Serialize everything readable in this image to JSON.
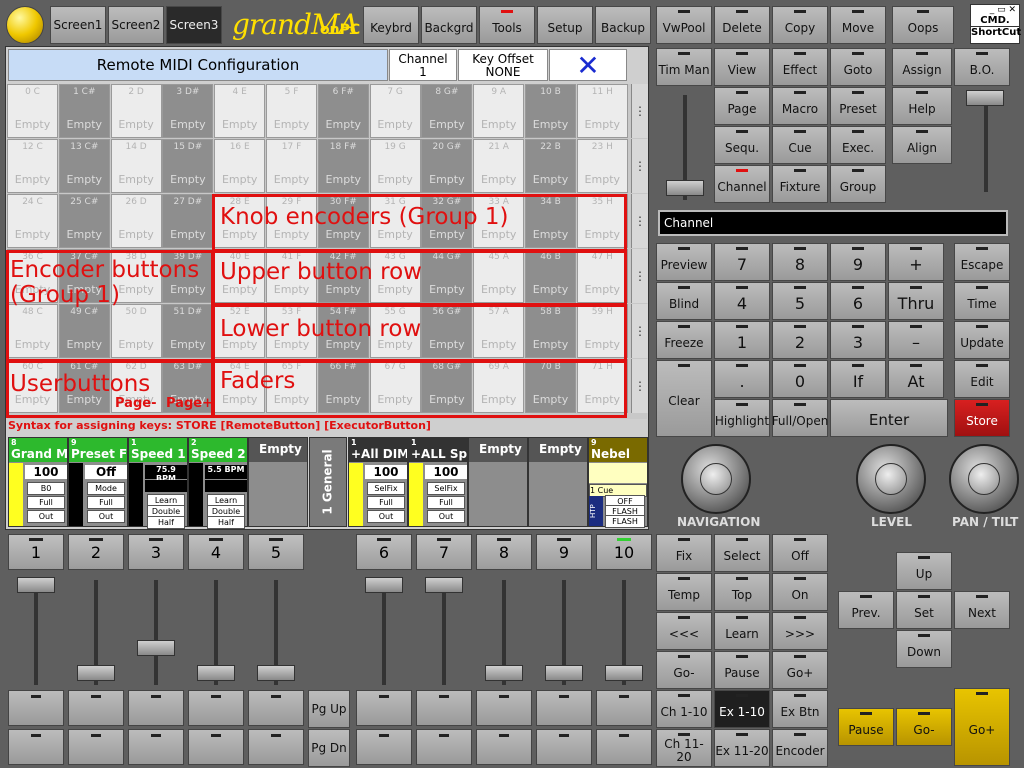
{
  "top_tabs": [
    "Screen1",
    "Screen2",
    "Screen3"
  ],
  "logo": {
    "main": "grandMA",
    "sub": "onPC"
  },
  "tools": [
    "Keybrd",
    "Backgrd",
    "Tools",
    "Setup",
    "Backup"
  ],
  "window_ctrl": {
    "cmd": "CMD.",
    "shortcut": "ShortCut"
  },
  "dialog": {
    "title": "Remote MIDI Configuration",
    "channel_label": "Channel",
    "channel_value": "1",
    "key_offset_label": "Key Offset",
    "key_offset_value": "NONE",
    "close": "✕"
  },
  "grid": {
    "rows": [
      [
        "0 C",
        "1 C#",
        "2 D",
        "3 D#",
        "4 E",
        "5 F",
        "6 F#",
        "7 G",
        "8 G#",
        "9 A",
        "10 B",
        "11 H"
      ],
      [
        "12 C",
        "13 C#",
        "14 D",
        "15 D#",
        "16 E",
        "17 F",
        "18 F#",
        "19 G",
        "20 G#",
        "21 A",
        "22 B",
        "23 H"
      ],
      [
        "24 C",
        "25 C#",
        "26 D",
        "27 D#",
        "28 E",
        "29 F",
        "30 F#",
        "31 G",
        "32 G#",
        "33 A",
        "34 B",
        "35 H"
      ],
      [
        "36 C",
        "37 C#",
        "38 D",
        "39 D#",
        "40 E",
        "41 F",
        "42 F#",
        "43 G",
        "44 G#",
        "45 A",
        "46 B",
        "47 H"
      ],
      [
        "48 C",
        "49 C#",
        "50 D",
        "51 D#",
        "52 E",
        "53 F",
        "54 F#",
        "55 G",
        "56 G#",
        "57 A",
        "58 B",
        "59 H"
      ],
      [
        "60 C",
        "61 C#",
        "62 D",
        "63 D#",
        "64 E",
        "65 F",
        "66 F#",
        "67 G",
        "68 G#",
        "69 A",
        "70 B",
        "71 H"
      ]
    ],
    "empty": "Empty",
    "more": "⋮"
  },
  "annotations": {
    "knob": "Knob encoders (Group 1)",
    "encoder_buttons": "Encoder buttons\n(Group 1)",
    "upper": "Upper button row",
    "lower": "Lower button row",
    "userbuttons": "Userbuttons",
    "faders": "Faders",
    "page_minus": "Page-",
    "page_plus": "Page+"
  },
  "syntax": "Syntax for assigning keys: STORE [RemoteButton] [ExecutorButton]",
  "executors": [
    {
      "num": "8",
      "title": "Grand Ma",
      "val": "100",
      "b1": "B0",
      "b2": "Full",
      "b3": "Out"
    },
    {
      "num": "9",
      "title": "Preset Fa",
      "val": "Off",
      "b1": "Mode",
      "b2": "Full",
      "b3": "Out"
    },
    {
      "num": "1",
      "title": "Speed 1",
      "val": "75.9 BPM",
      "b1": "Learn",
      "b2": "Double",
      "b3": "Half"
    },
    {
      "num": "2",
      "title": "Speed 2",
      "val": "5.5 BPM",
      "b1": "Learn",
      "b2": "Double",
      "b3": "Half"
    },
    {
      "num": "",
      "title": "Empty"
    },
    {
      "num": "1",
      "title": "+All DIMM",
      "val": "100",
      "b1": "SelFix",
      "b2": "Full",
      "b3": "Out"
    },
    {
      "num": "1",
      "title": "+ALL Spo",
      "val": "100",
      "b1": "SelFix",
      "b2": "Full",
      "b3": "Out"
    },
    {
      "num": "",
      "title": "Empty"
    },
    {
      "num": "",
      "title": "Empty"
    },
    {
      "num": "9",
      "title": "Nebel",
      "cue": "1 Cue",
      "htp": "HTP",
      "b1": "OFF",
      "b2": "FLASH",
      "b3": "FLASH"
    }
  ],
  "page_label": "1 General",
  "fader_numbers": [
    "1",
    "2",
    "3",
    "4",
    "5",
    "6",
    "7",
    "8",
    "9",
    "10"
  ],
  "pg_buttons": [
    "Pg Up",
    "Pg Dn"
  ],
  "right_top": [
    "VwPool",
    "Delete",
    "Copy",
    "Move",
    "Oops"
  ],
  "right_keys": {
    "r1": [
      "Tim Man",
      "View",
      "Effect",
      "Goto",
      "Assign"
    ],
    "bo": "B.O.",
    "r2": [
      "Page",
      "Macro",
      "Preset",
      "Help"
    ],
    "r3": [
      "Sequ.",
      "Cue",
      "Exec.",
      "Align"
    ],
    "r4": [
      "Channel",
      "Fixture",
      "Group"
    ]
  },
  "cmdline": "Channel",
  "keypad": {
    "left": [
      "Preview",
      "Blind",
      "Freeze",
      "Clear"
    ],
    "nums": [
      [
        "7",
        "8",
        "9",
        "+"
      ],
      [
        "4",
        "5",
        "6",
        "Thru"
      ],
      [
        "1",
        "2",
        "3",
        "–"
      ],
      [
        ".",
        "0",
        "If",
        "At"
      ]
    ],
    "right": [
      "Escape",
      "Time",
      "Update",
      "Edit",
      "Store"
    ],
    "bottom": [
      "Highlight",
      "Full/Open",
      "Enter"
    ]
  },
  "encoders": [
    "NAVIGATION",
    "LEVEL",
    "PAN / TILT"
  ],
  "lower_right": [
    [
      "Fix",
      "Select",
      "Off"
    ],
    [
      "Temp",
      "Top",
      "On"
    ],
    [
      "<<<",
      "Learn",
      ">>>"
    ],
    [
      "Go-",
      "Pause",
      "Go+"
    ],
    [
      "Ch 1-10",
      "Ex 1-10",
      "Ex Btn"
    ],
    [
      "Ch 11-20",
      "Ex 11-20",
      "Encoder"
    ]
  ],
  "nav": {
    "up": "Up",
    "prev": "Prev.",
    "set": "Set",
    "next": "Next",
    "down": "Down"
  },
  "playback": [
    "Pause",
    "Go-",
    "Go+"
  ],
  "colors": {
    "accent_red": "#e01010",
    "exec_yellow": "#ffff20",
    "exec_green": "#2db92d",
    "playback_yellow": "#d8b400"
  }
}
